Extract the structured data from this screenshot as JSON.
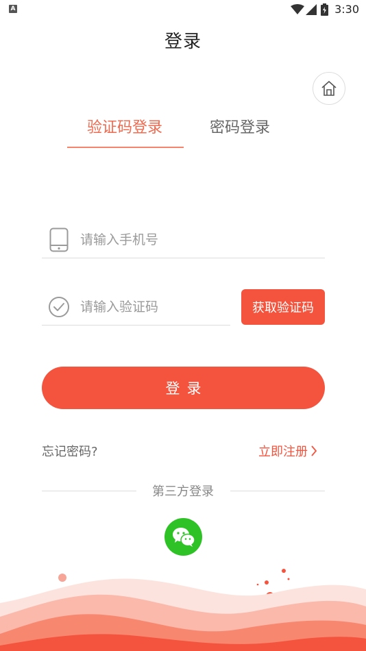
{
  "status_bar": {
    "notification_icon": "A",
    "time": "3:30",
    "icons": [
      "wifi-icon",
      "signal-icon",
      "battery-icon"
    ]
  },
  "header": {
    "title": "登录"
  },
  "home_button": {
    "icon": "home-icon"
  },
  "tabs": [
    {
      "label": "验证码登录",
      "active": true
    },
    {
      "label": "密码登录",
      "active": false
    }
  ],
  "form": {
    "phone": {
      "icon": "phone-icon",
      "placeholder": "请输入手机号",
      "value": ""
    },
    "code": {
      "icon": "check-circle-icon",
      "placeholder": "请输入验证码",
      "value": ""
    },
    "get_code_label": "获取验证码",
    "login_label": "登录"
  },
  "links": {
    "forgot": "忘记密码?",
    "register": "立即注册"
  },
  "third_party": {
    "label": "第三方登录",
    "providers": [
      {
        "icon": "wechat-icon"
      }
    ]
  },
  "colors": {
    "accent": "#f4533d",
    "tab_active": "#f06a4f",
    "wechat": "#2fc226"
  }
}
